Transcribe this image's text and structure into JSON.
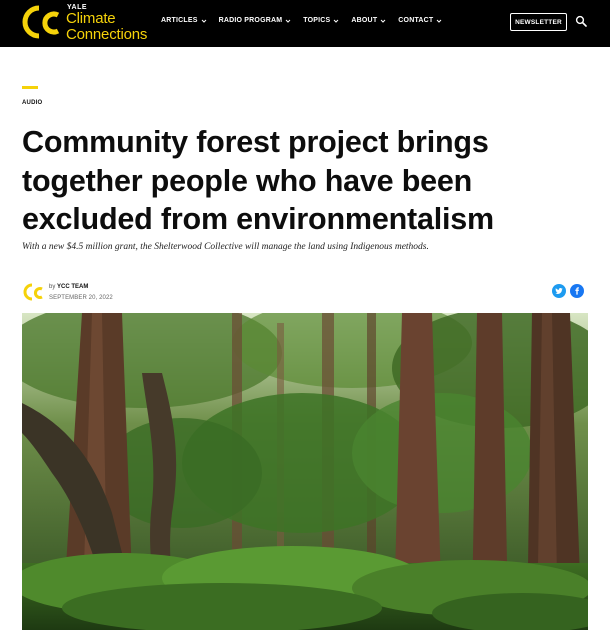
{
  "site": {
    "logo_small": "YALE",
    "logo_line1": "Climate",
    "logo_line2": "Connections",
    "brand_color": "#f5d20a"
  },
  "nav": {
    "items": [
      {
        "label": "ARTICLES"
      },
      {
        "label": "RADIO PROGRAM"
      },
      {
        "label": "TOPICS"
      },
      {
        "label": "ABOUT"
      },
      {
        "label": "CONTACT"
      }
    ],
    "newsletter_label": "NEWSLETTER",
    "search_icon": "search-icon"
  },
  "article": {
    "category": "AUDIO",
    "headline": "Community forest project brings together people who have been excluded from environmentalism",
    "dek": "With a new $4.5 million grant, the Shelterwood Collective will manage the land using Indigenous methods.",
    "byline_prefix": "by",
    "author": "YCC TEAM",
    "date": "SEPTEMBER 20, 2022",
    "share": [
      {
        "network": "twitter",
        "icon": "twitter-icon",
        "color": "#1d9bf0"
      },
      {
        "network": "facebook",
        "icon": "facebook-icon",
        "color": "#1877f2"
      }
    ],
    "hero_image": "redwood-forest-photo"
  }
}
